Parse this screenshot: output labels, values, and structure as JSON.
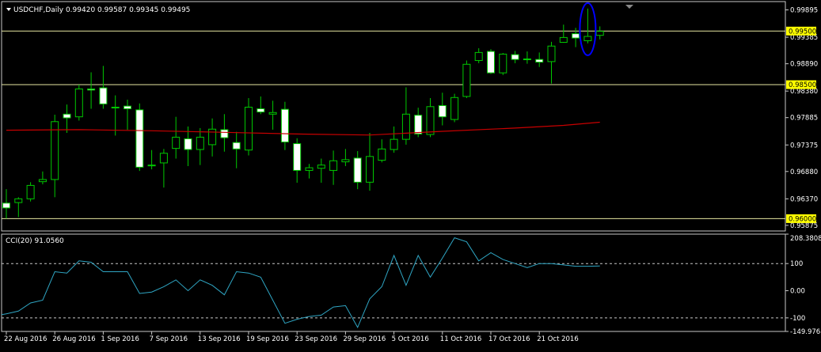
{
  "colors": {
    "background": "#000000",
    "frame": "#c8c8c8",
    "candle_up": "#00c800",
    "candle_down_fill": "#ffffff",
    "candle_wick": "#00c800",
    "moving_average": "#c80000",
    "level_line": "#e6e6a0",
    "cci_line": "#2fa6c4",
    "price_tag_bg": "#ffff00",
    "annotation_ellipse": "#0000ff",
    "text": "#ffffff"
  },
  "price_panel": {
    "header": "USDCHF,Daily  0.99420 0.99587 0.99345 0.99495",
    "y_ticks": [
      "0.99895",
      "0.99385",
      "0.98890",
      "0.98380",
      "0.97885",
      "0.97375",
      "0.96880",
      "0.96370",
      "0.95875"
    ],
    "level_tags": [
      "0.99500",
      "0.98500",
      "0.96000"
    ]
  },
  "cci_panel": {
    "header": "CCI(20) 91.0560",
    "y_ticks": [
      "208.3808",
      "100",
      "0.00",
      "-100",
      "-149.9768"
    ]
  },
  "x_ticks": [
    "22 Aug 2016",
    "26 Aug 2016",
    "1 Sep 2016",
    "7 Sep 2016",
    "13 Sep 2016",
    "19 Sep 2016",
    "23 Sep 2016",
    "29 Sep 2016",
    "5 Oct 2016",
    "11 Oct 2016",
    "17 Oct 2016",
    "21 Oct 2016"
  ],
  "chart_data": [
    {
      "type": "candlestick",
      "title": "USDCHF,Daily",
      "ohlc_last": {
        "open": 0.9942,
        "high": 0.99587,
        "low": 0.99345,
        "close": 0.99495
      },
      "ylim": [
        0.9577,
        1.0005
      ],
      "levels": [
        0.995,
        0.985,
        0.96
      ],
      "candles": [
        {
          "o": 0.9629,
          "h": 0.9655,
          "l": 0.96,
          "c": 0.962
        },
        {
          "o": 0.963,
          "h": 0.964,
          "l": 0.9603,
          "c": 0.9637
        },
        {
          "o": 0.9637,
          "h": 0.9668,
          "l": 0.9632,
          "c": 0.9662
        },
        {
          "o": 0.9669,
          "h": 0.9688,
          "l": 0.9664,
          "c": 0.9673
        },
        {
          "o": 0.9673,
          "h": 0.9794,
          "l": 0.964,
          "c": 0.9781
        },
        {
          "o": 0.9795,
          "h": 0.9813,
          "l": 0.976,
          "c": 0.9788
        },
        {
          "o": 0.979,
          "h": 0.985,
          "l": 0.9783,
          "c": 0.9842
        },
        {
          "o": 0.9842,
          "h": 0.9873,
          "l": 0.9805,
          "c": 0.984
        },
        {
          "o": 0.9844,
          "h": 0.9885,
          "l": 0.9805,
          "c": 0.9814
        },
        {
          "o": 0.9808,
          "h": 0.983,
          "l": 0.9755,
          "c": 0.9807
        },
        {
          "o": 0.981,
          "h": 0.9822,
          "l": 0.9766,
          "c": 0.9805
        },
        {
          "o": 0.9803,
          "h": 0.9815,
          "l": 0.9689,
          "c": 0.9696
        },
        {
          "o": 0.9699,
          "h": 0.9728,
          "l": 0.9692,
          "c": 0.97
        },
        {
          "o": 0.9704,
          "h": 0.973,
          "l": 0.9658,
          "c": 0.9722
        },
        {
          "o": 0.9731,
          "h": 0.979,
          "l": 0.9712,
          "c": 0.9752
        },
        {
          "o": 0.9749,
          "h": 0.9772,
          "l": 0.9698,
          "c": 0.9729
        },
        {
          "o": 0.9729,
          "h": 0.9769,
          "l": 0.97,
          "c": 0.9752
        },
        {
          "o": 0.9738,
          "h": 0.9787,
          "l": 0.9716,
          "c": 0.9767
        },
        {
          "o": 0.9766,
          "h": 0.9795,
          "l": 0.9725,
          "c": 0.9751
        },
        {
          "o": 0.9742,
          "h": 0.9762,
          "l": 0.9694,
          "c": 0.973
        },
        {
          "o": 0.9728,
          "h": 0.9825,
          "l": 0.9718,
          "c": 0.9808
        },
        {
          "o": 0.9805,
          "h": 0.9828,
          "l": 0.9795,
          "c": 0.9799
        },
        {
          "o": 0.9795,
          "h": 0.982,
          "l": 0.9766,
          "c": 0.9798
        },
        {
          "o": 0.9804,
          "h": 0.9818,
          "l": 0.9728,
          "c": 0.9743
        },
        {
          "o": 0.974,
          "h": 0.975,
          "l": 0.9667,
          "c": 0.969
        },
        {
          "o": 0.969,
          "h": 0.9702,
          "l": 0.9675,
          "c": 0.9695
        },
        {
          "o": 0.9694,
          "h": 0.9712,
          "l": 0.9667,
          "c": 0.97
        },
        {
          "o": 0.969,
          "h": 0.9727,
          "l": 0.9663,
          "c": 0.9708
        },
        {
          "o": 0.9706,
          "h": 0.973,
          "l": 0.9698,
          "c": 0.971
        },
        {
          "o": 0.9713,
          "h": 0.9726,
          "l": 0.9655,
          "c": 0.9668
        },
        {
          "o": 0.9668,
          "h": 0.976,
          "l": 0.9652,
          "c": 0.9716
        },
        {
          "o": 0.9709,
          "h": 0.9748,
          "l": 0.9705,
          "c": 0.973
        },
        {
          "o": 0.9729,
          "h": 0.9772,
          "l": 0.9723,
          "c": 0.9748
        },
        {
          "o": 0.9748,
          "h": 0.9845,
          "l": 0.9738,
          "c": 0.9795
        },
        {
          "o": 0.9793,
          "h": 0.9807,
          "l": 0.9752,
          "c": 0.9758
        },
        {
          "o": 0.9757,
          "h": 0.9825,
          "l": 0.9752,
          "c": 0.9809
        },
        {
          "o": 0.9811,
          "h": 0.9835,
          "l": 0.9774,
          "c": 0.979
        },
        {
          "o": 0.9785,
          "h": 0.9833,
          "l": 0.978,
          "c": 0.9826
        },
        {
          "o": 0.9828,
          "h": 0.9895,
          "l": 0.9825,
          "c": 0.9888
        },
        {
          "o": 0.9895,
          "h": 0.9918,
          "l": 0.989,
          "c": 0.991
        },
        {
          "o": 0.9912,
          "h": 0.9916,
          "l": 0.987,
          "c": 0.9872
        },
        {
          "o": 0.9872,
          "h": 0.9909,
          "l": 0.9868,
          "c": 0.9907
        },
        {
          "o": 0.9906,
          "h": 0.9913,
          "l": 0.989,
          "c": 0.9897
        },
        {
          "o": 0.9897,
          "h": 0.9912,
          "l": 0.9889,
          "c": 0.9898
        },
        {
          "o": 0.9897,
          "h": 0.991,
          "l": 0.9883,
          "c": 0.9892
        },
        {
          "o": 0.9893,
          "h": 0.993,
          "l": 0.9852,
          "c": 0.9922
        },
        {
          "o": 0.9929,
          "h": 0.9962,
          "l": 0.9928,
          "c": 0.9938
        },
        {
          "o": 0.9945,
          "h": 0.9956,
          "l": 0.992,
          "c": 0.9937
        },
        {
          "o": 0.9932,
          "h": 0.9992,
          "l": 0.9927,
          "c": 0.994
        },
        {
          "o": 0.9942,
          "h": 0.99587,
          "l": 0.99345,
          "c": 0.99495
        }
      ],
      "moving_average": [
        {
          "i": 0,
          "v": 0.9765
        },
        {
          "i": 6,
          "v": 0.9766
        },
        {
          "i": 12,
          "v": 0.9764
        },
        {
          "i": 18,
          "v": 0.9761
        },
        {
          "i": 24,
          "v": 0.9758
        },
        {
          "i": 30,
          "v": 0.9756
        },
        {
          "i": 36,
          "v": 0.9763
        },
        {
          "i": 42,
          "v": 0.9769
        },
        {
          "i": 46,
          "v": 0.9774
        },
        {
          "i": 49,
          "v": 0.978
        }
      ]
    },
    {
      "type": "line",
      "title": "CCI(20) 91.0560",
      "ylim": [
        -149.9768,
        208.3808
      ],
      "levels": [
        100,
        -100
      ],
      "series": [
        {
          "name": "CCI(20)",
          "values": [
            -85,
            -75,
            -45,
            -35,
            70,
            65,
            110,
            105,
            70,
            70,
            70,
            -10,
            -5,
            15,
            40,
            0,
            40,
            20,
            -15,
            70,
            65,
            50,
            -35,
            -120,
            -105,
            -95,
            -90,
            -60,
            -55,
            -135,
            -30,
            15,
            130,
            20,
            130,
            50,
            120,
            195,
            180,
            110,
            140,
            115,
            100,
            85,
            100,
            100,
            95,
            90,
            90,
            91.056
          ]
        }
      ]
    }
  ]
}
